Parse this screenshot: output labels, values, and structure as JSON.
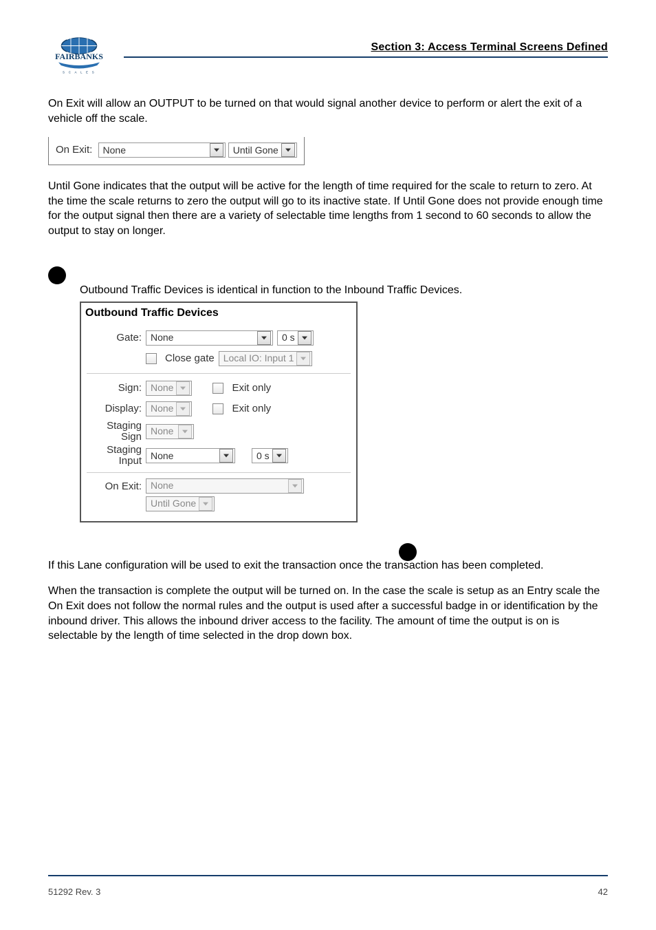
{
  "header": {
    "section_title": "Section 3:  Access Terminal Screens Defined",
    "logo_text_top": "FAIRBANKS",
    "logo_text_bottom": "SCALES"
  },
  "explain_before_strip": "On Exit will allow an OUTPUT to be turned on that would signal another device to perform or alert the exit of a vehicle off the scale.",
  "ui_strip": {
    "label": "On Exit:",
    "select1": "None",
    "select2": "Until Gone"
  },
  "until_gone_para": "Until Gone indicates that the output will be active for the length of time required for the scale to return to zero.  At the time the scale returns to zero the output will go to its inactive state.  If Until Gone does not provide enough time for the output signal then there are a variety of selectable time lengths from 1 second to 60 seconds to allow the output to stay on longer.",
  "outbound_intro": "Outbound Traffic Devices is identical in function to the Inbound Traffic Devices.",
  "panel": {
    "title": "Outbound Traffic Devices",
    "rows": {
      "gate_label": "Gate:",
      "gate_value": "None",
      "gate_time": "0 s",
      "close_gate_check_label": "Close gate",
      "close_gate_select": "Local IO: Input 1",
      "sign_label": "Sign:",
      "sign_value": "None",
      "sign_exit_only": "Exit only",
      "display_label": "Display:",
      "display_value": "None",
      "display_exit_only": "Exit only",
      "staging_sign_label": "Staging\nSign",
      "staging_sign_value": "None",
      "staging_input_label": "Staging\nInput",
      "staging_input_value": "None",
      "staging_input_time": "0 s",
      "onexit_label": "On Exit:",
      "onexit_select1": "None",
      "onexit_select2": "Until Gone"
    }
  },
  "trailer_bullet": "If this Lane configuration will be used to exit the transaction once the transaction has been completed.",
  "trailer_para": "When the transaction is complete the output will be turned on.  In the case the scale is setup as an Entry scale the On Exit does not follow the normal rules and the output is used after a successful badge in or identification by the inbound driver.  This allows the inbound driver access to the facility.  The amount of time the output is on is selectable by the length of time selected in the drop down box.",
  "footer": {
    "left": "51292 Rev. 3",
    "right": "42"
  }
}
